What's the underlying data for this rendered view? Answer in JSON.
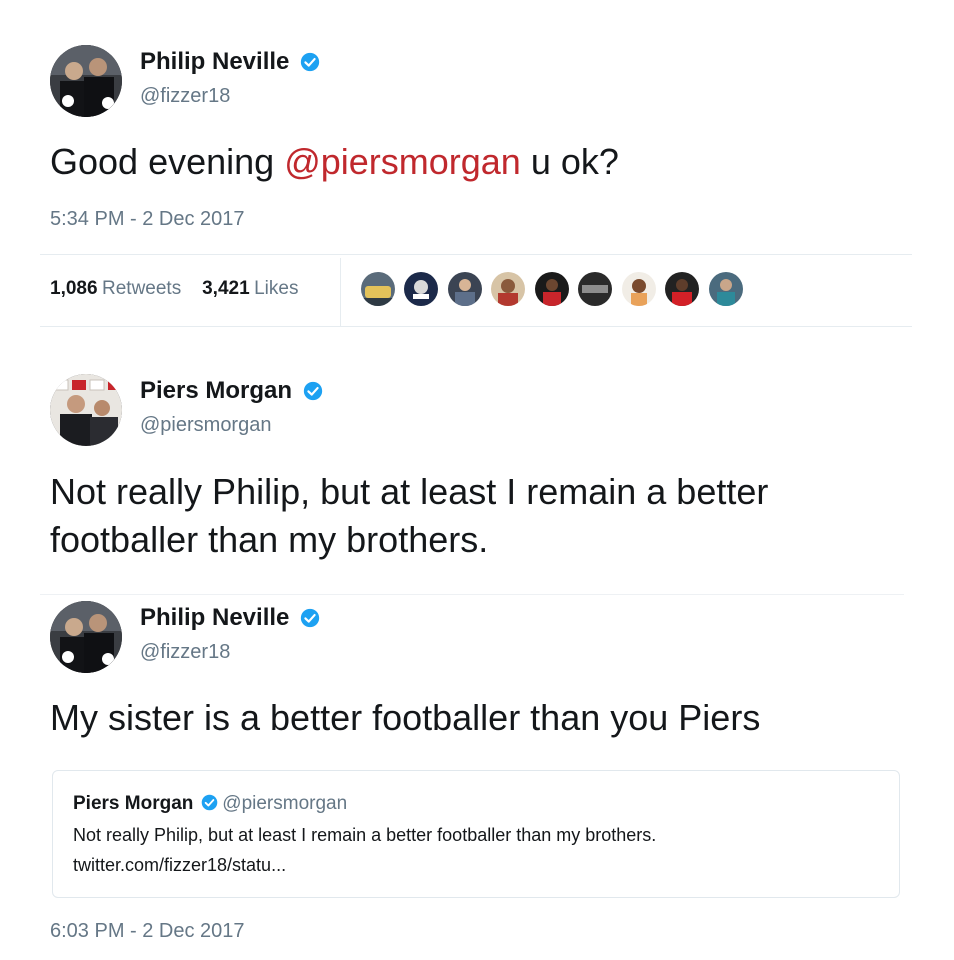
{
  "tweet1": {
    "name": "Philip Neville",
    "handle": "@fizzer18",
    "text_before": "Good evening ",
    "mention": "@piersmorgan",
    "text_after": " u ok?",
    "timestamp": "5:34 PM - 2 Dec 2017",
    "retweets_count": "1,086",
    "retweets_label": "Retweets",
    "likes_count": "3,421",
    "likes_label": "Likes",
    "likers": [
      "liker-1",
      "liker-2",
      "liker-3",
      "liker-4",
      "liker-5",
      "liker-6",
      "liker-7",
      "liker-8",
      "liker-9",
      "liker-10"
    ]
  },
  "tweet2": {
    "name": "Piers Morgan",
    "handle": "@piersmorgan",
    "text_line1": "Not really Philip, but at least I remain a better",
    "text_line2": "footballer than my brothers."
  },
  "tweet3": {
    "name": "Philip Neville",
    "handle": "@fizzer18",
    "text": "My sister is a better footballer than you Piers",
    "quote": {
      "name": "Piers Morgan",
      "handle": "@piersmorgan",
      "text": "Not really Philip, but at least I remain a better footballer than my brothers.",
      "link": "twitter.com/fizzer18/statu..."
    },
    "timestamp": "6:03 PM - 2 Dec 2017"
  },
  "colors": {
    "mention": "#c0282d",
    "verified": "#1da1f2",
    "secondary_text": "#657786",
    "divider": "#e6ecf0"
  },
  "icons": {
    "verified": "verified-badge-icon"
  }
}
